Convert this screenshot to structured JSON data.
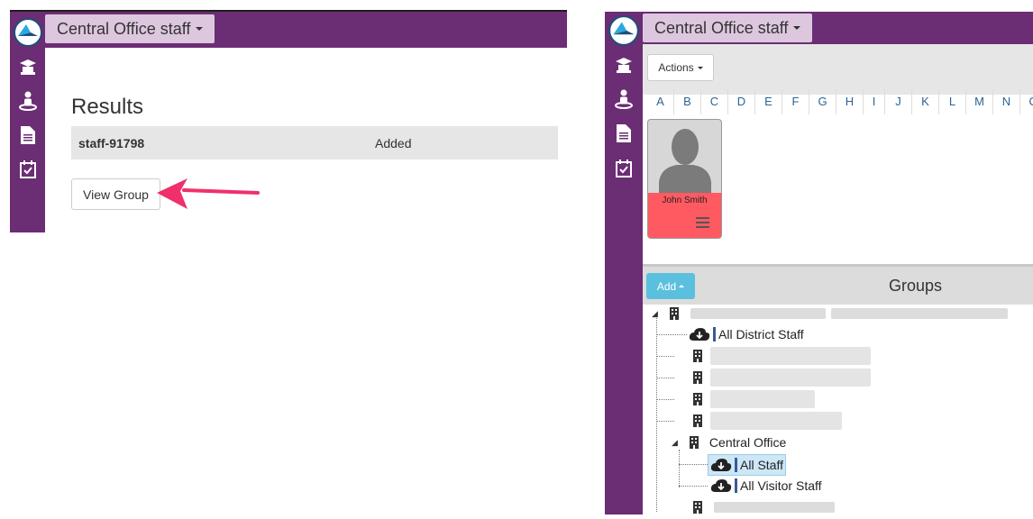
{
  "left_panel": {
    "header_dropdown": "Central Office staff",
    "results_title": "Results",
    "result_row": {
      "name": "staff-91798",
      "status": "Added"
    },
    "view_group_button": "View Group"
  },
  "right_panel": {
    "header_dropdown": "Central Office staff",
    "actions_button": "Actions",
    "alphabet": [
      "A",
      "B",
      "C",
      "D",
      "E",
      "F",
      "G",
      "H",
      "I",
      "J",
      "K",
      "L",
      "M",
      "N",
      "O"
    ],
    "person_card": {
      "name": "John Smith",
      "card_color": "#ff5a62"
    },
    "add_button": "Add",
    "groups_title": "Groups",
    "tree": {
      "all_district_staff": "All District Staff",
      "central_office": "Central Office",
      "all_staff": "All Staff",
      "all_visitor_staff": "All Visitor Staff"
    }
  },
  "sidebar_icons": [
    "app-logo-icon",
    "graduation-cap-icon",
    "student-icon",
    "document-icon",
    "calendar-check-icon"
  ],
  "colors": {
    "brand_purple": "#6b2d74",
    "dropdown_bg": "#dcc7de",
    "accent_blue": "#5bc0de",
    "arrow_pink": "#f0306a"
  }
}
